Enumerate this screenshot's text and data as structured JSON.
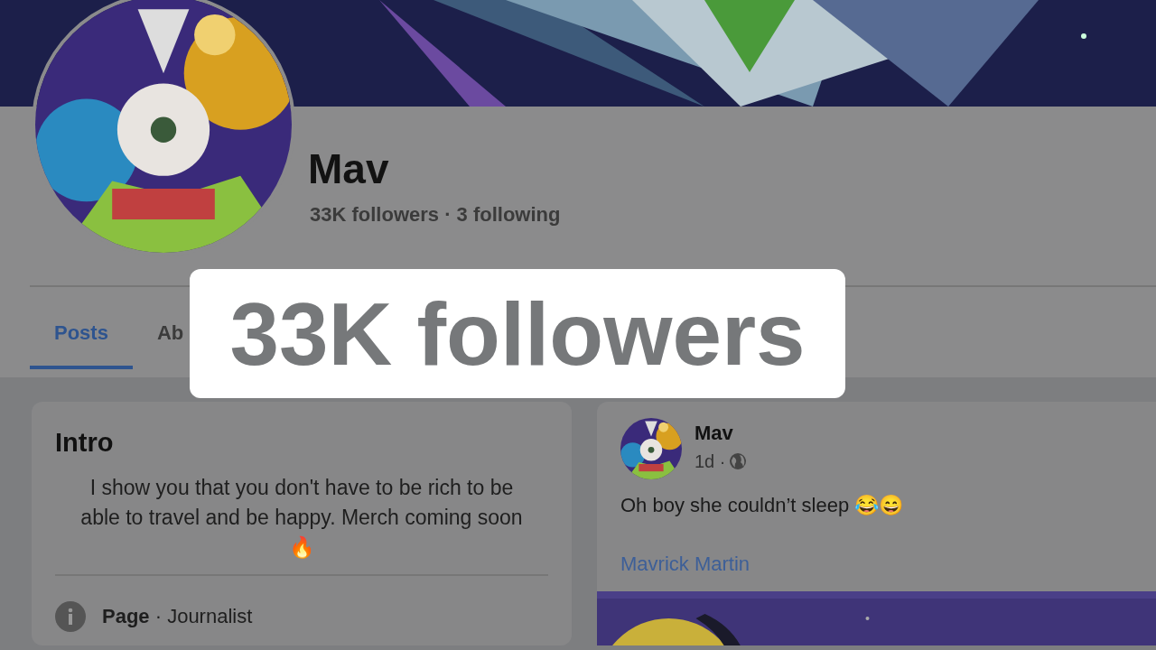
{
  "profile": {
    "name": "Mav",
    "stats": "33K followers · 3 following"
  },
  "tabs": [
    {
      "label": "Posts",
      "selected": true
    },
    {
      "label": "Ab",
      "selected": false
    }
  ],
  "caption": {
    "text": "33K followers"
  },
  "intro": {
    "title": "Intro",
    "bio": "I show you that you don't have to be rich to be able to travel and be happy. Merch coming soon 🔥",
    "details": [
      {
        "kind": "info",
        "text": "**Page** · Journalist"
      }
    ]
  },
  "post": {
    "author": "Mav",
    "time": "1d ·",
    "public": true,
    "text": "Oh boy she couldn’t sleep 😂😄",
    "link": "Mavrick Martin"
  }
}
